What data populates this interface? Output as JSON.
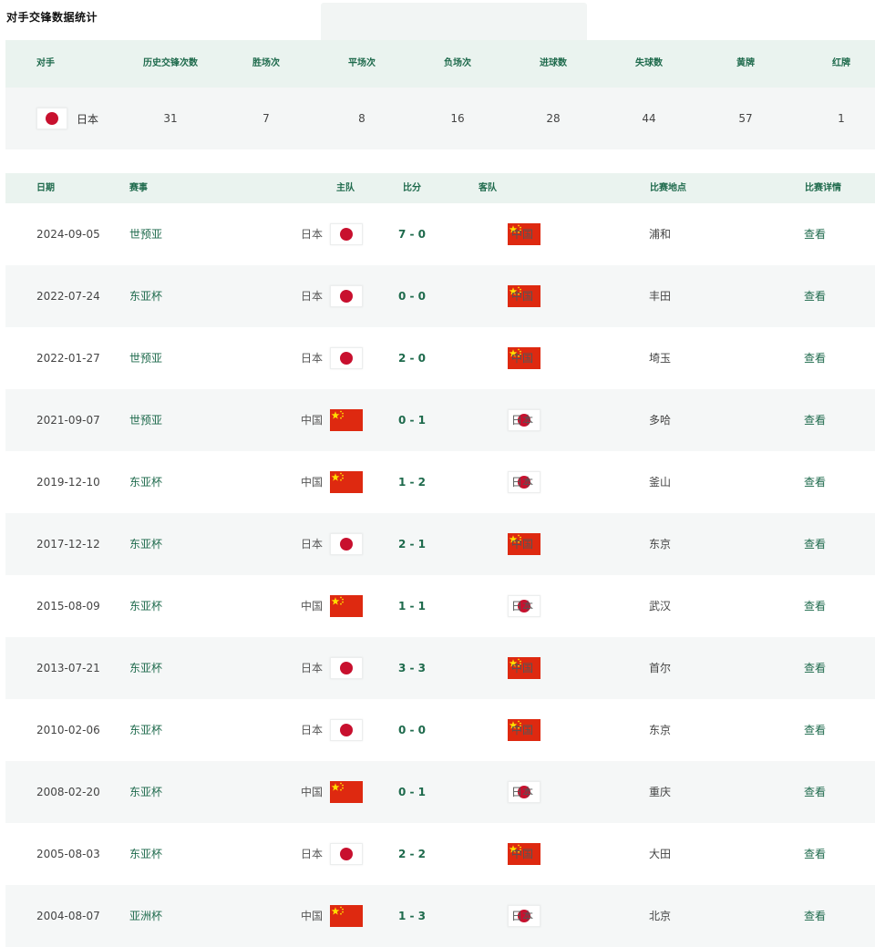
{
  "page_title": "对手交锋数据统计",
  "summary": {
    "headers": [
      "对手",
      "历史交锋次数",
      "胜场次",
      "平场次",
      "负场次",
      "进球数",
      "失球数",
      "黄牌",
      "红牌"
    ],
    "opponent": "日本",
    "stats": [
      "31",
      "7",
      "8",
      "16",
      "28",
      "44",
      "57",
      "1"
    ]
  },
  "table": {
    "headers": {
      "date": "日期",
      "competition": "赛事",
      "home": "主队",
      "score": "比分",
      "away": "客队",
      "venue": "比赛地点",
      "detail": "比赛详情"
    },
    "rows": [
      {
        "date": "2024-09-05",
        "competition": "世预亚",
        "home": "日本",
        "home_flag": "jp",
        "score": "7 - 0",
        "away": "中国",
        "away_flag": "cn",
        "venue": "浦和",
        "detail": "查看"
      },
      {
        "date": "2022-07-24",
        "competition": "东亚杯",
        "home": "日本",
        "home_flag": "jp",
        "score": "0 - 0",
        "away": "中国",
        "away_flag": "cn",
        "venue": "丰田",
        "detail": "查看"
      },
      {
        "date": "2022-01-27",
        "competition": "世预亚",
        "home": "日本",
        "home_flag": "jp",
        "score": "2 - 0",
        "away": "中国",
        "away_flag": "cn",
        "venue": "埼玉",
        "detail": "查看"
      },
      {
        "date": "2021-09-07",
        "competition": "世预亚",
        "home": "中国",
        "home_flag": "cn",
        "score": "0 - 1",
        "away": "日本",
        "away_flag": "jp",
        "venue": "多哈",
        "detail": "查看"
      },
      {
        "date": "2019-12-10",
        "competition": "东亚杯",
        "home": "中国",
        "home_flag": "cn",
        "score": "1 - 2",
        "away": "日本",
        "away_flag": "jp",
        "venue": "釜山",
        "detail": "查看"
      },
      {
        "date": "2017-12-12",
        "competition": "东亚杯",
        "home": "日本",
        "home_flag": "jp",
        "score": "2 - 1",
        "away": "中国",
        "away_flag": "cn",
        "venue": "东京",
        "detail": "查看"
      },
      {
        "date": "2015-08-09",
        "competition": "东亚杯",
        "home": "中国",
        "home_flag": "cn",
        "score": "1 - 1",
        "away": "日本",
        "away_flag": "jp",
        "venue": "武汉",
        "detail": "查看"
      },
      {
        "date": "2013-07-21",
        "competition": "东亚杯",
        "home": "日本",
        "home_flag": "jp",
        "score": "3 - 3",
        "away": "中国",
        "away_flag": "cn",
        "venue": "首尔",
        "detail": "查看"
      },
      {
        "date": "2010-02-06",
        "competition": "东亚杯",
        "home": "日本",
        "home_flag": "jp",
        "score": "0 - 0",
        "away": "中国",
        "away_flag": "cn",
        "venue": "东京",
        "detail": "查看"
      },
      {
        "date": "2008-02-20",
        "competition": "东亚杯",
        "home": "中国",
        "home_flag": "cn",
        "score": "0 - 1",
        "away": "日本",
        "away_flag": "jp",
        "venue": "重庆",
        "detail": "查看"
      },
      {
        "date": "2005-08-03",
        "competition": "东亚杯",
        "home": "日本",
        "home_flag": "jp",
        "score": "2 - 2",
        "away": "中国",
        "away_flag": "cn",
        "venue": "大田",
        "detail": "查看"
      },
      {
        "date": "2004-08-07",
        "competition": "亚洲杯",
        "home": "中国",
        "home_flag": "cn",
        "score": "1 - 3",
        "away": "日本",
        "away_flag": "jp",
        "venue": "北京",
        "detail": "查看"
      }
    ]
  },
  "colors": {
    "accent": "#1e6a4c",
    "header_bg": "#eaf3ef",
    "alt_row_bg": "#f5f7f7",
    "japan_red": "#c8102e",
    "china_red": "#de2910",
    "china_star": "#ffde00"
  },
  "icons": {
    "jp": "japan-flag-icon",
    "cn": "china-flag-icon"
  }
}
